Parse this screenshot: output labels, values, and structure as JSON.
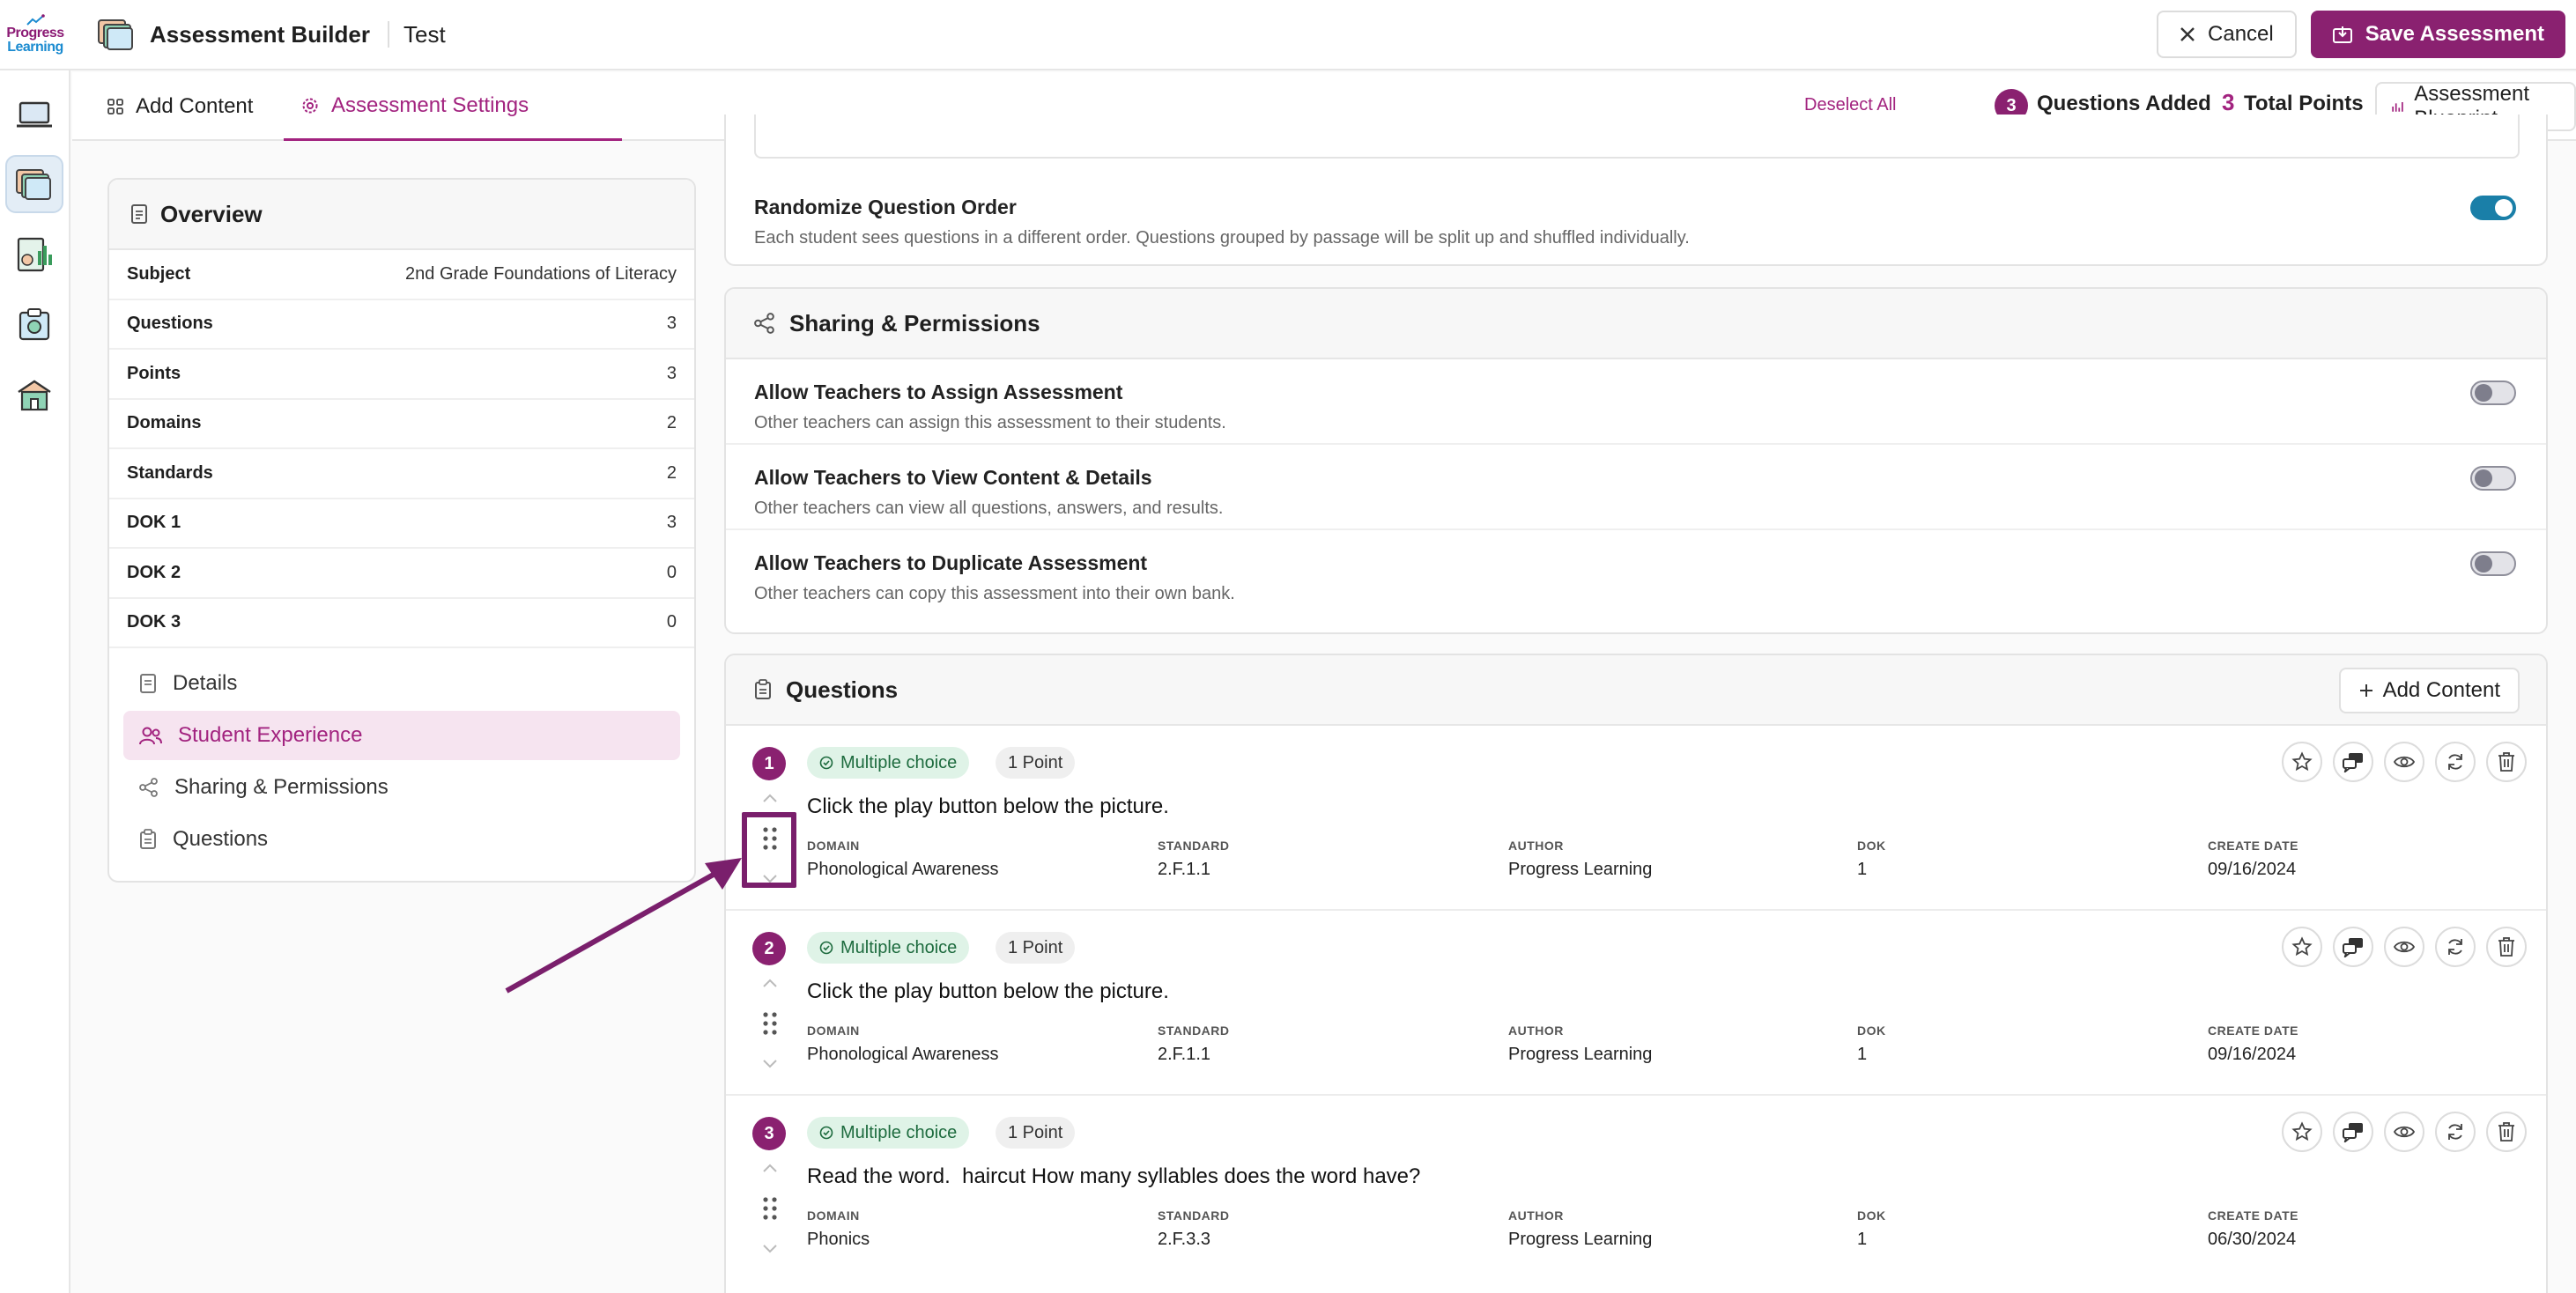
{
  "app": {
    "logo_line1": "Progress",
    "logo_line2": "Learning",
    "title": "Assessment Builder",
    "document_name": "Test"
  },
  "header": {
    "cancel_label": "Cancel",
    "save_label": "Save Assessment"
  },
  "tabs": [
    {
      "label": "Add Content",
      "icon": "grid-icon",
      "active": false
    },
    {
      "label": "Assessment Settings",
      "icon": "gear-icon",
      "active": true
    }
  ],
  "summary": {
    "deselect_label": "Deselect All",
    "questions_count": "3",
    "questions_label": "Questions Added",
    "points_count": "3",
    "points_label": "Total Points",
    "blueprint_label": "Assessment Blueprint"
  },
  "overview": {
    "title": "Overview",
    "rows": [
      {
        "key": "Subject",
        "value": "2nd Grade Foundations of Literacy"
      },
      {
        "key": "Questions",
        "value": "3"
      },
      {
        "key": "Points",
        "value": "3"
      },
      {
        "key": "Domains",
        "value": "2"
      },
      {
        "key": "Standards",
        "value": "2"
      },
      {
        "key": "DOK 1",
        "value": "3"
      },
      {
        "key": "DOK 2",
        "value": "0"
      },
      {
        "key": "DOK 3",
        "value": "0"
      }
    ],
    "nav": [
      {
        "label": "Details",
        "active": false
      },
      {
        "label": "Student Experience",
        "active": true
      },
      {
        "label": "Sharing & Permissions",
        "active": false
      },
      {
        "label": "Questions",
        "active": false
      }
    ]
  },
  "student_experience": {
    "randomize_title": "Randomize Question Order",
    "randomize_desc": "Each student sees questions in a different order. Questions grouped by passage will be split up and shuffled individually.",
    "randomize_on": true
  },
  "sharing": {
    "title": "Sharing & Permissions",
    "settings": [
      {
        "title": "Allow Teachers to Assign Assessment",
        "desc": "Other teachers can assign this assessment to their students.",
        "on": false
      },
      {
        "title": "Allow Teachers to View Content & Details",
        "desc": "Other teachers can view all questions, answers, and results.",
        "on": false
      },
      {
        "title": "Allow Teachers to Duplicate Assessment",
        "desc": "Other teachers can copy this assessment into their own bank.",
        "on": false
      }
    ]
  },
  "questions": {
    "title": "Questions",
    "add_content_label": "Add Content",
    "meta_labels": {
      "domain": "DOMAIN",
      "standard": "STANDARD",
      "author": "AUTHOR",
      "dok": "DOK",
      "create_date": "CREATE DATE"
    },
    "items": [
      {
        "number": "1",
        "type": "Multiple choice",
        "points": "1 Point",
        "text": "Click the play button below the picture.",
        "domain": "Phonological Awareness",
        "standard": "2.F.1.1",
        "author": "Progress Learning",
        "dok": "1",
        "create_date": "09/16/2024"
      },
      {
        "number": "2",
        "type": "Multiple choice",
        "points": "1 Point",
        "text": "Click the play button below the picture.",
        "domain": "Phonological Awareness",
        "standard": "2.F.1.1",
        "author": "Progress Learning",
        "dok": "1",
        "create_date": "09/16/2024"
      },
      {
        "number": "3",
        "type": "Multiple choice",
        "points": "1 Point",
        "text": "Read the word.  haircut How many syllables does the word have?",
        "domain": "Phonics",
        "standard": "2.F.3.3",
        "author": "Progress Learning",
        "dok": "1",
        "create_date": "06/30/2024"
      }
    ]
  },
  "colors": {
    "brand": "#8a2170",
    "accent": "#a2237f",
    "toggle_on": "#1a7fa8",
    "chip_green": "#dff3e7"
  }
}
